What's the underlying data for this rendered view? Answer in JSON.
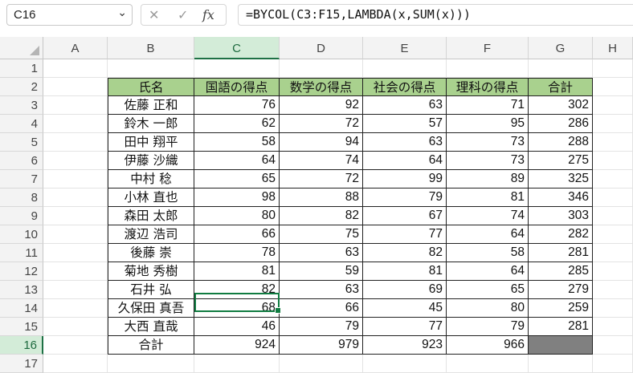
{
  "formula_bar": {
    "name_box": "C16",
    "name_box_arrow": "⌄",
    "cancel_icon": "✕",
    "enter_icon": "✓",
    "fx_icon": "fx",
    "formula": "=BYCOL(C3:F15,LAMBDA(x,SUM(x)))"
  },
  "columns": [
    "A",
    "B",
    "C",
    "D",
    "E",
    "F",
    "G",
    "H"
  ],
  "selected_column": "C",
  "rows": [
    "1",
    "2",
    "3",
    "4",
    "5",
    "6",
    "7",
    "8",
    "9",
    "10",
    "11",
    "12",
    "13",
    "14",
    "15",
    "16",
    "17"
  ],
  "selected_row": "16",
  "table": {
    "headers": [
      "氏名",
      "国語の得点",
      "数学の得点",
      "社会の得点",
      "理科の得点",
      "合計"
    ],
    "header_color": "#a9d18e",
    "records": [
      {
        "name": "佐藤 正和",
        "scores": [
          "76",
          "92",
          "63",
          "71"
        ],
        "total": "302"
      },
      {
        "name": "鈴木 一郎",
        "scores": [
          "62",
          "72",
          "57",
          "95"
        ],
        "total": "286"
      },
      {
        "name": "田中 翔平",
        "scores": [
          "58",
          "94",
          "63",
          "73"
        ],
        "total": "288"
      },
      {
        "name": "伊藤 沙織",
        "scores": [
          "64",
          "74",
          "64",
          "73"
        ],
        "total": "275"
      },
      {
        "name": "中村 稔",
        "scores": [
          "65",
          "72",
          "99",
          "89"
        ],
        "total": "325"
      },
      {
        "name": "小林 直也",
        "scores": [
          "98",
          "88",
          "79",
          "81"
        ],
        "total": "346"
      },
      {
        "name": "森田 太郎",
        "scores": [
          "80",
          "82",
          "67",
          "74"
        ],
        "total": "303"
      },
      {
        "name": "渡辺 浩司",
        "scores": [
          "66",
          "75",
          "77",
          "64"
        ],
        "total": "282"
      },
      {
        "name": "後藤 崇",
        "scores": [
          "78",
          "63",
          "82",
          "58"
        ],
        "total": "281"
      },
      {
        "name": "菊地 秀樹",
        "scores": [
          "81",
          "59",
          "81",
          "64"
        ],
        "total": "285"
      },
      {
        "name": "石井 弘",
        "scores": [
          "82",
          "63",
          "69",
          "65"
        ],
        "total": "279"
      },
      {
        "name": "久保田 真吾",
        "scores": [
          "68",
          "66",
          "45",
          "80"
        ],
        "total": "259"
      },
      {
        "name": "大西 直哉",
        "scores": [
          "46",
          "79",
          "77",
          "79"
        ],
        "total": "281"
      }
    ],
    "footer_label": "合計",
    "footer_values": [
      "924",
      "979",
      "923",
      "966"
    ],
    "footer_empty_color": "#808080"
  }
}
